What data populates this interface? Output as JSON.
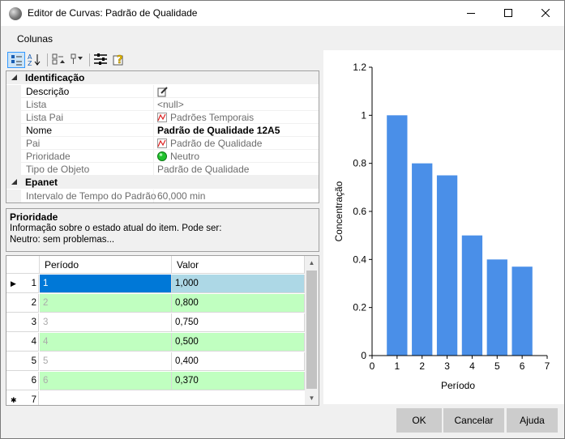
{
  "window": {
    "title": "Editor de Curvas: Padrão de Qualidade"
  },
  "menu": {
    "columns": "Colunas"
  },
  "toolbar": {
    "buttons": [
      "categorized-icon",
      "sort-alpha-icon",
      "expand-icon",
      "filter-icon",
      "properties-icon",
      "help-icon"
    ]
  },
  "properties": {
    "identification": {
      "header": "Identificação",
      "rows": [
        {
          "name": "Descrição",
          "value": "",
          "icon": "edit-icon"
        },
        {
          "name": "Lista",
          "value": "<null>"
        },
        {
          "name": "Lista Pai",
          "value": "Padrões Temporais",
          "icon": "chart-icon"
        },
        {
          "name": "Nome",
          "value": "Padrão de Qualidade 12A5"
        },
        {
          "name": "Pai",
          "value": "Padrão de Qualidade",
          "icon": "chart-icon"
        },
        {
          "name": "Prioridade",
          "value": "Neutro",
          "icon": "green-status-icon"
        },
        {
          "name": "Tipo de Objeto",
          "value": "Padrão de Qualidade"
        }
      ]
    },
    "epanet": {
      "header": "Epanet",
      "rows": [
        {
          "name": "Intervalo de Tempo do Padrão",
          "value": "60,000 min"
        }
      ]
    }
  },
  "help": {
    "title": "Prioridade",
    "text": "Informação sobre o estado atual do item. Pode ser:\nNeutro: sem problemas..."
  },
  "table": {
    "columns": [
      "Período",
      "Valor"
    ],
    "rows": [
      {
        "num": "1",
        "period": "1",
        "value": "1,000"
      },
      {
        "num": "2",
        "period": "2",
        "value": "0,800"
      },
      {
        "num": "3",
        "period": "3",
        "value": "0,750"
      },
      {
        "num": "4",
        "period": "4",
        "value": "0,500"
      },
      {
        "num": "5",
        "period": "5",
        "value": "0,400"
      },
      {
        "num": "6",
        "period": "6",
        "value": "0,370"
      }
    ],
    "new_row_num": "7",
    "colors": {
      "selected": "#0078d7",
      "selected_value": "#add8e6",
      "alt": "#c0ffc0"
    }
  },
  "chart_data": {
    "type": "bar",
    "x": [
      1,
      2,
      3,
      4,
      5,
      6
    ],
    "values": [
      1.0,
      0.8,
      0.75,
      0.5,
      0.4,
      0.37
    ],
    "xlabel": "Período",
    "ylabel": "Concentração",
    "xlim": [
      0,
      7
    ],
    "ylim": [
      0,
      1.2
    ],
    "xticks": [
      "0",
      "1",
      "2",
      "3",
      "4",
      "5",
      "6",
      "7"
    ],
    "yticks": [
      "0",
      "0.2",
      "0.4",
      "0.6",
      "0.8",
      "1",
      "1.2"
    ],
    "color": "#4a8fe8",
    "grid": false
  },
  "buttons": {
    "ok": "OK",
    "cancel": "Cancelar",
    "help": "Ajuda"
  }
}
